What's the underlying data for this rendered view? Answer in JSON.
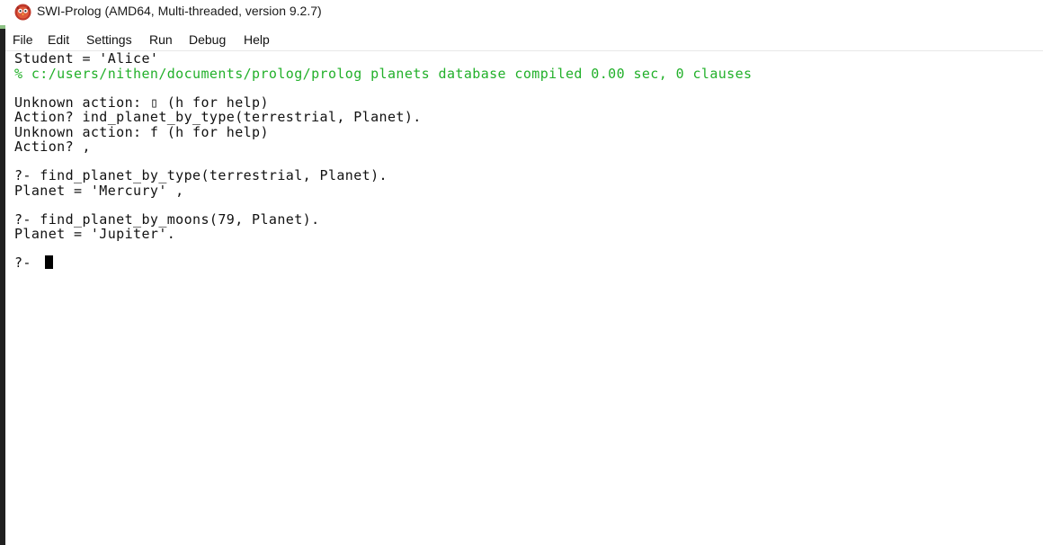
{
  "window": {
    "title": "SWI-Prolog (AMD64, Multi-threaded, version 9.2.7)",
    "app_icon": "swi-prolog-owl-icon",
    "accent_color": "#22b02a"
  },
  "menu": {
    "items": [
      {
        "label": "File"
      },
      {
        "label": "Edit"
      },
      {
        "label": "Settings"
      },
      {
        "label": "Run"
      },
      {
        "label": "Debug"
      },
      {
        "label": "Help"
      }
    ]
  },
  "console": {
    "lines": [
      {
        "text": "Student = 'Alice'",
        "style": "normal"
      },
      {
        "text": "% c:/users/nithen/documents/prolog/prolog planets database compiled 0.00 sec, 0 clauses",
        "style": "green"
      },
      {
        "text": "",
        "style": "normal"
      },
      {
        "text": "Unknown action: ▯ (h for help)",
        "style": "normal"
      },
      {
        "text": "Action? ind_planet_by_type(terrestrial, Planet).",
        "style": "normal"
      },
      {
        "text": "Unknown action: f (h for help)",
        "style": "normal"
      },
      {
        "text": "Action? ,",
        "style": "normal"
      },
      {
        "text": "",
        "style": "normal"
      },
      {
        "text": "?- find_planet_by_type(terrestrial, Planet).",
        "style": "normal"
      },
      {
        "text": "Planet = 'Mercury' ,",
        "style": "normal"
      },
      {
        "text": "",
        "style": "normal"
      },
      {
        "text": "?- find_planet_by_moons(79, Planet).",
        "style": "normal"
      },
      {
        "text": "Planet = 'Jupiter'.",
        "style": "normal"
      },
      {
        "text": "",
        "style": "normal"
      },
      {
        "text": "?- ",
        "style": "normal"
      }
    ]
  }
}
